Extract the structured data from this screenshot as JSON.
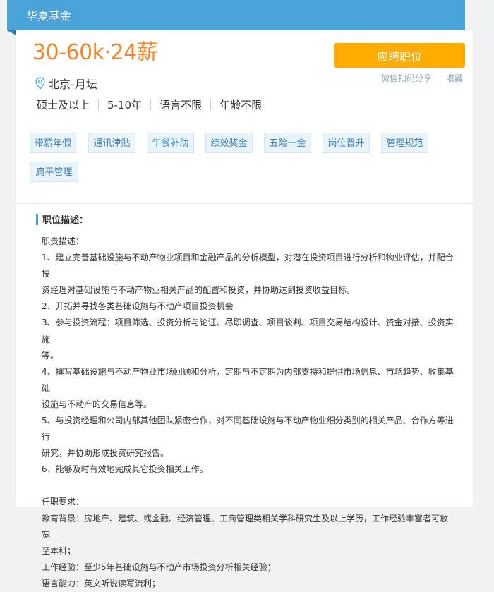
{
  "header": {
    "company": "华夏基金",
    "colors": {
      "accent": "#4aa4d9",
      "salary": "#f5862c",
      "button": "#ffac00"
    }
  },
  "job": {
    "salary": "30-60k·24薪",
    "location": "北京-月坛",
    "location_icon": "map-pin-icon",
    "requirements": [
      "硕士及以上",
      "5-10年",
      "语言不限",
      "年龄不限"
    ]
  },
  "actions": {
    "apply_label": "应聘职位",
    "share_label": "微信扫码分享",
    "collect_label": "收藏"
  },
  "tags": [
    "带薪年假",
    "通讯津贴",
    "午餐补助",
    "绩效奖金",
    "五险一金",
    "岗位晋升",
    "管理规范",
    "扁平管理"
  ],
  "description": {
    "title": "职位描述：",
    "lines": [
      "职责描述：",
      "1、建立完善基础设施与不动产物业项目和金融产品的分析模型，对潜在投资项目进行分析和物业评估，并配合投",
      "资经理对基础设施与不动产物业相关产品的配置和投资，并协助达到投资收益目标。",
      "2、开拓并寻找各类基础设施与不动产项目投资机会",
      "3、参与投资流程：项目筛选、投资分析与论证、尽职调查、项目谈判、项目交易结构设计、资金对接、投资实施",
      "等。",
      "4、撰写基础设施与不动产物业市场回顾和分析，定期与不定期为内部支持和提供市场信息、市场趋势、收集基础",
      "设施与不动产的交易信息等。",
      "5、与投资经理和公司内部其他团队紧密合作，对不同基础设施与不动产物业细分类别的相关产品、合作方等进行",
      "研究，并协助形成投资研究报告。",
      "6、能够及时有效地完成其它投资相关工作。",
      "",
      "任职要求：",
      "教育背景：房地产、建筑、或金融、经济管理、工商管理类相关学科研究生及以上学历，工作经验丰富者可放宽",
      "至本科；",
      "工作经验：至少5年基础设施与不动产市场投资分析相关经验；",
      "语言能力：英文听说读写流利；"
    ]
  }
}
